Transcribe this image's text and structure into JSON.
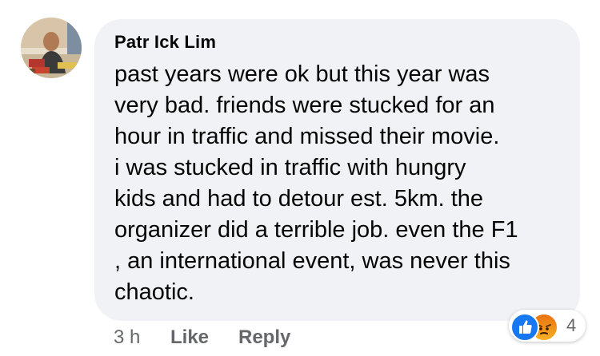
{
  "comment": {
    "author": "Patr Ick Lim",
    "text_lines": [
      "past years were ok but this year was",
      "very bad. friends were stucked for an",
      "hour in traffic and missed their movie.",
      "i was stucked in traffic with hungry",
      "kids and had to detour est. 5km.  the",
      "organizer did a terrible job. even the F1",
      ", an international event, was never this",
      "chaotic."
    ],
    "time": "3 h",
    "like_label": "Like",
    "reply_label": "Reply",
    "reactions": {
      "icons": [
        "like-icon",
        "angry-icon"
      ],
      "count": "4"
    }
  },
  "colors": {
    "bubble": "#f0f2f5",
    "like_blue": "#1877f2",
    "meta_gray": "#65676b"
  }
}
